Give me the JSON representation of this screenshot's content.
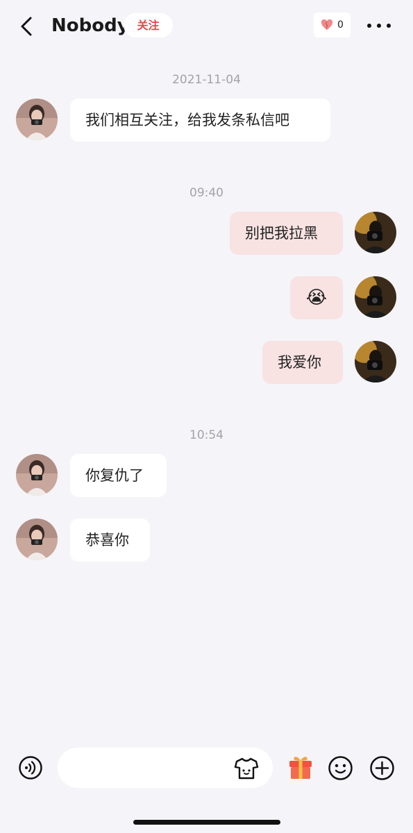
{
  "header": {
    "back_icon": "chevron-left-icon",
    "title": "Nobody",
    "follow_label": "关注",
    "likes_icon": "heart-icon",
    "likes_count": "0",
    "more_icon": "more-horizontal-icon"
  },
  "messages": [
    {
      "type": "timestamp",
      "text": "2021-11-04"
    },
    {
      "type": "message",
      "side": "left",
      "text": "我们相互关注，给我发条私信吧"
    },
    {
      "type": "timestamp",
      "text": "09:40"
    },
    {
      "type": "message",
      "side": "right",
      "text": "别把我拉黑"
    },
    {
      "type": "message",
      "side": "right",
      "text": "😭"
    },
    {
      "type": "message",
      "side": "right",
      "text": "我爱你"
    },
    {
      "type": "timestamp",
      "text": "10:54"
    },
    {
      "type": "message",
      "side": "left",
      "text": "你复仇了"
    },
    {
      "type": "message",
      "side": "left",
      "text": "恭喜你"
    }
  ],
  "bottom_bar": {
    "voice_icon": "voice-icon",
    "input_placeholder": "",
    "input_value": "",
    "shirt_icon": "shirt-icon",
    "gift_icon": "gift-icon",
    "emoji_icon": "smile-icon",
    "add_icon": "plus-circle-icon"
  },
  "colors": {
    "background": "#f5f4f8",
    "self_bubble": "#f8e2e2",
    "other_bubble": "#ffffff",
    "follow_text": "#e24a4a",
    "gift": "#f0533f"
  }
}
